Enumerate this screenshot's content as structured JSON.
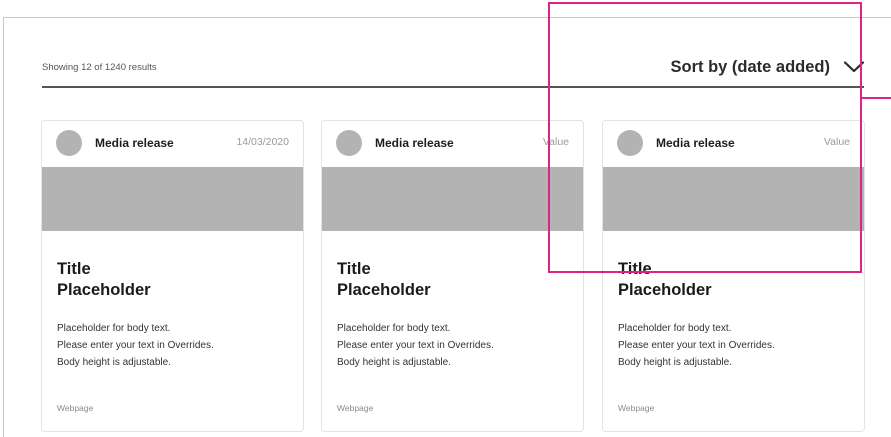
{
  "results": {
    "count_text": "Showing 12 of 1240 results"
  },
  "sort": {
    "label": "Sort by (date added)",
    "icon": "chevron-down-icon"
  },
  "cards": [
    {
      "type": "Media release",
      "meta": "14/03/2020",
      "title_line1": "Title",
      "title_line2": "Placeholder",
      "body": [
        "Placeholder for body text.",
        "Please enter your text in Overrides.",
        "Body height is adjustable."
      ],
      "footer": "Webpage"
    },
    {
      "type": "Media release",
      "meta": "Value",
      "title_line1": "Title",
      "title_line2": "Placeholder",
      "body": [
        "Placeholder for body text.",
        "Please enter your text in Overrides.",
        "Body height is adjustable."
      ],
      "footer": "Webpage"
    },
    {
      "type": "Media release",
      "meta": "Value",
      "title_line1": "Title",
      "title_line2": "Placeholder",
      "body": [
        "Placeholder for body text.",
        "Please enter your text in Overrides.",
        "Body height is adjustable."
      ],
      "footer": "Webpage"
    }
  ],
  "colors": {
    "highlight": "#e0218a",
    "placeholder_gray": "#b3b3b3",
    "divider": "#555555"
  }
}
